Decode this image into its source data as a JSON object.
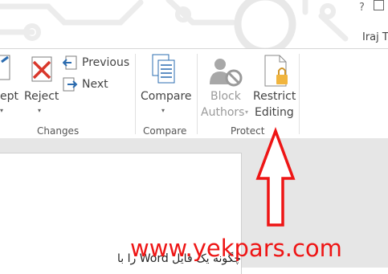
{
  "titlebar": {
    "help": "?",
    "user": "Iraj T"
  },
  "ribbon": {
    "changes": {
      "accept_label": "ept",
      "reject_label": "Reject",
      "previous_label": "Previous",
      "next_label": "Next",
      "group_label": "Changes"
    },
    "compare": {
      "button_label": "Compare",
      "group_label": "Compare"
    },
    "protect": {
      "block_line1": "Block",
      "block_line2": "Authors",
      "restrict_line1": "Restrict",
      "restrict_line2": "Editing",
      "group_label": "Protect"
    }
  },
  "document": {
    "text": "چگونه یک فایل Word را با"
  },
  "watermark": "www.yekpars.com",
  "colors": {
    "annotation": "#ee1515",
    "ribbon_bg": "#ffffff",
    "doc_bg": "#e6e6e6"
  }
}
